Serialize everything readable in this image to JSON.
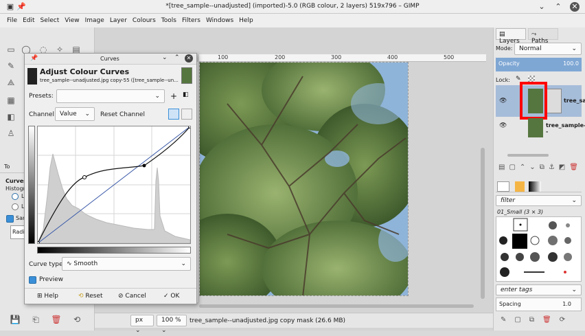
{
  "window": {
    "title": "*[tree_sample--unadjusted] (imported)-5.0 (RGB colour, 2 layers) 519x796 – GIMP"
  },
  "menu": [
    "File",
    "Edit",
    "Select",
    "View",
    "Image",
    "Layer",
    "Colours",
    "Tools",
    "Filters",
    "Windows",
    "Help"
  ],
  "ruler": {
    "ticks": [
      "100",
      "200",
      "300",
      "400",
      "500"
    ]
  },
  "toolOptions": {
    "tab": "To",
    "section": "Curves",
    "histogram": "Histogr",
    "radio1": "L",
    "radio2": "L",
    "samples": "Sam",
    "radius": "Radi"
  },
  "curves": {
    "title": "Curves",
    "header": "Adjust Colour Curves",
    "subheader": "tree_sample--unadjusted.jpg copy-55 ([tree_sample--un...",
    "presets_label": "Presets:",
    "preset_value": "",
    "channel_label": "Channel:",
    "channel_value": "Value",
    "reset_channel": "Reset Channel",
    "curve_type_label": "Curve type:",
    "curve_type_value": "Smooth",
    "preview_label": "Preview",
    "help": "Help",
    "reset": "Reset",
    "cancel": "Cancel",
    "ok": "OK"
  },
  "status": {
    "unit": "px",
    "zoom": "100 %",
    "message": "tree_sample--unadjusted.jpg copy mask (26.6 MB)"
  },
  "layers": {
    "tab_layers": "Layers",
    "tab_paths": "Paths",
    "mode_label": "Mode:",
    "mode_value": "Normal",
    "opacity_label": "Opacity",
    "opacity_value": "100.0",
    "lock_label": "Lock:",
    "layer1": "tree_sa",
    "layer2": "tree_sample--"
  },
  "brushes": {
    "filter": "filter",
    "name": "01_Small (3 × 3)",
    "tags": "enter tags",
    "spacing_label": "Spacing",
    "spacing_value": "1.0"
  },
  "colors": {
    "accent": "#3a8fd8",
    "opacity_bar": "#7fa7d4",
    "highlight": "#ff0000",
    "sky": "#8fb4d9",
    "foliage": "#4f6a3a"
  }
}
